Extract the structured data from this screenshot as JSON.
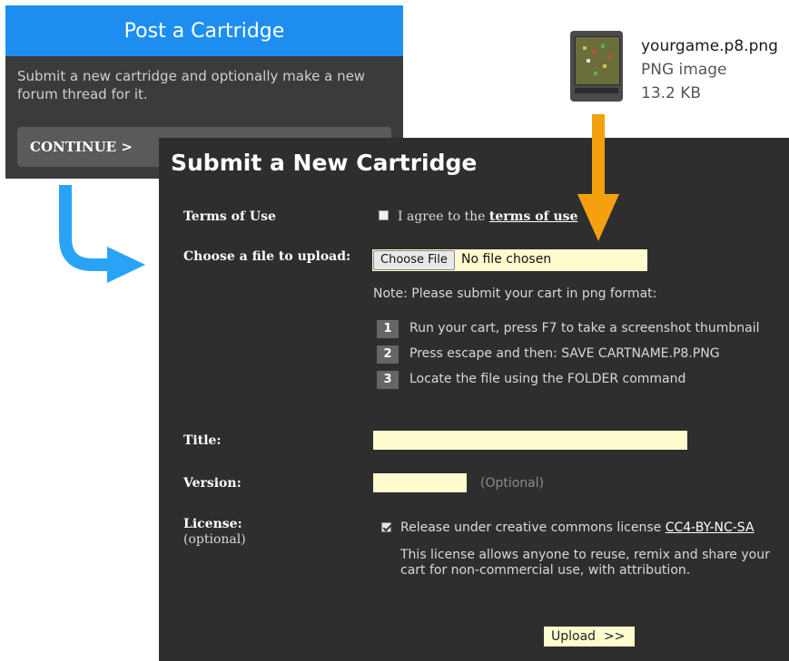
{
  "post_card": {
    "title": "Post a Cartridge",
    "description": "Submit a new cartridge and optionally make a new forum thread for it.",
    "continue_label": "CONTINUE >"
  },
  "file": {
    "name": "yourgame.p8.png",
    "type": "PNG image",
    "size": "13.2 KB",
    "icon": "pico8-cartridge-icon"
  },
  "submit": {
    "title": "Submit a New Cartridge",
    "terms": {
      "label": "Terms of Use",
      "agree_text": "I agree to the ",
      "link_text": "terms of use",
      "checked": false
    },
    "upload": {
      "label": "Choose a file to upload:",
      "button": "Choose File",
      "status": "No file chosen",
      "note": "Note: Please submit your cart in png format:"
    },
    "steps": [
      {
        "num": "1",
        "text": "Run your cart, press F7 to take a screenshot thumbnail"
      },
      {
        "num": "2",
        "text": "Press escape and then: SAVE CARTNAME.P8.PNG"
      },
      {
        "num": "3",
        "text": "Locate the file using the FOLDER command"
      }
    ],
    "title_field": {
      "label": "Title:",
      "value": ""
    },
    "version_field": {
      "label": "Version:",
      "value": "",
      "note": "(Optional)"
    },
    "license": {
      "label": "License:",
      "sublabel": "(optional)",
      "checked": true,
      "text": "Release under creative commons license ",
      "link_text": "CC4-BY-NC-SA",
      "description": "This license allows anyone to reuse, remix and share your cart for non-commercial use, with attribution."
    },
    "upload_button": "Upload  >>"
  },
  "colors": {
    "accent_blue": "#1d8ef0",
    "arrow_blue": "#29a3f5",
    "arrow_orange": "#f5a00f",
    "panel_dark": "#2e2e2e",
    "field_yellow": "#fffccf"
  }
}
